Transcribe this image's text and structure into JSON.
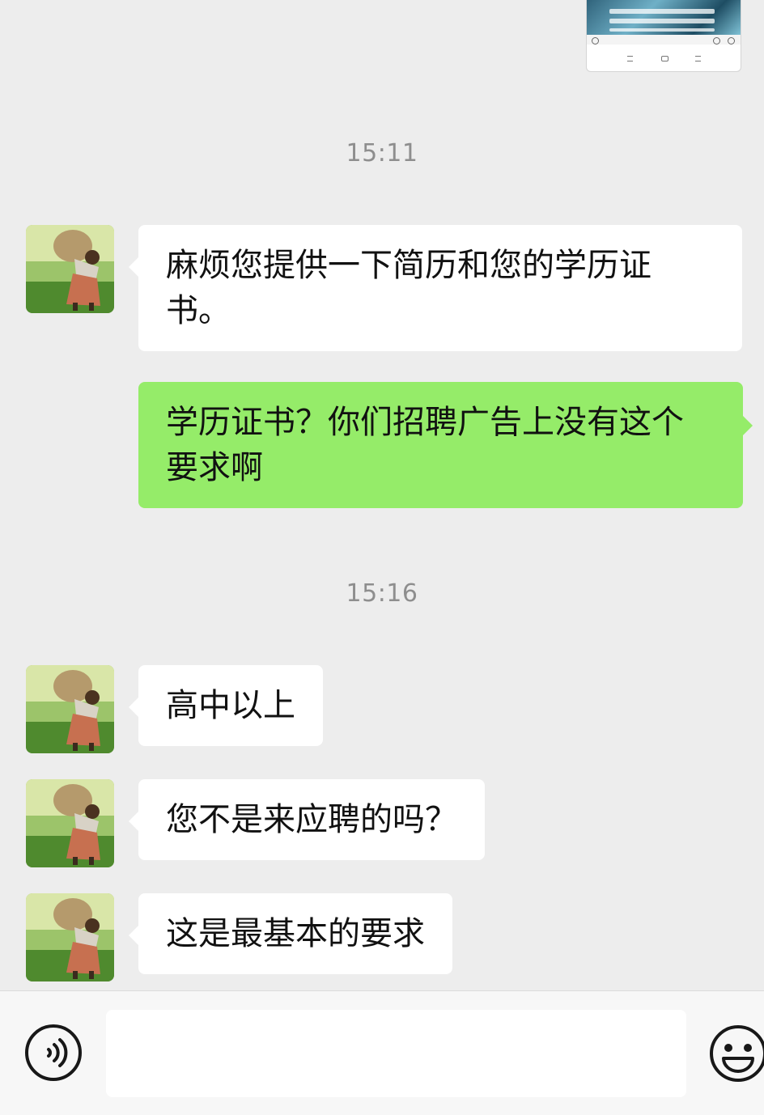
{
  "messages": [
    {
      "type": "timestamp",
      "text": "15:11"
    },
    {
      "type": "received",
      "text": "麻烦您提供一下简历和您的学历证书。"
    },
    {
      "type": "sent",
      "text": "学历证书？你们招聘广告上没有这个要求啊"
    },
    {
      "type": "timestamp",
      "text": "15:16"
    },
    {
      "type": "received",
      "text": "高中以上"
    },
    {
      "type": "received",
      "text": "您不是来应聘的吗？"
    },
    {
      "type": "received",
      "text": "这是最基本的要求"
    }
  ],
  "input_bar": {
    "placeholder": "",
    "voice_icon": "voice-icon",
    "emoji_icon": "emoji-icon"
  },
  "colors": {
    "background": "#ededed",
    "received_bubble": "#ffffff",
    "sent_bubble": "#95ec69",
    "timestamp": "#8e8e8e"
  }
}
